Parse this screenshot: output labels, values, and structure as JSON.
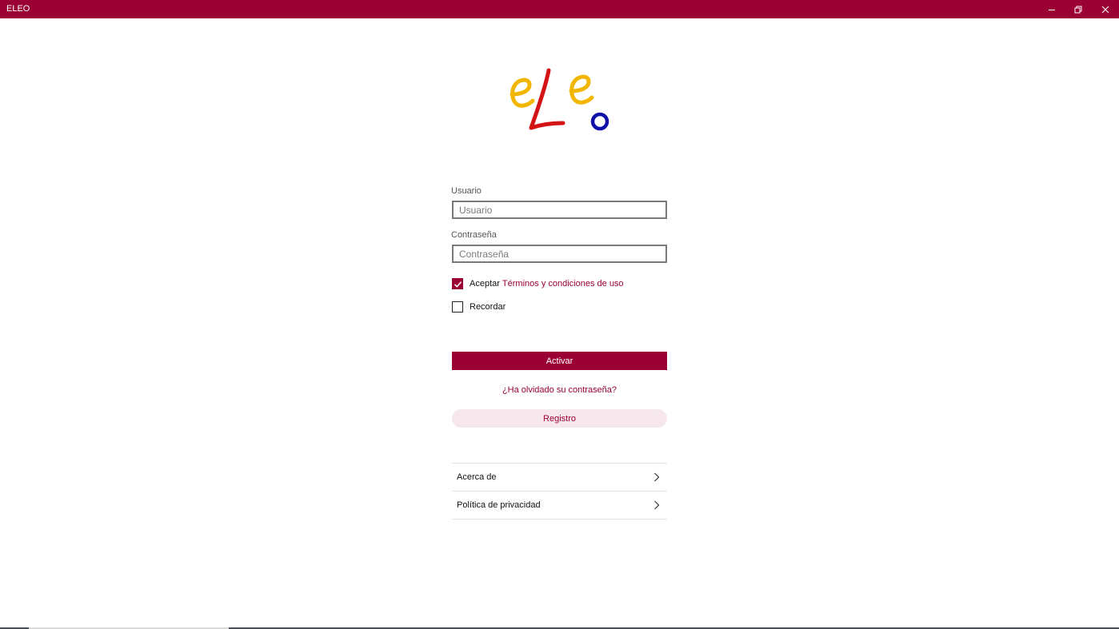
{
  "window": {
    "title": "ELEO",
    "minimize_icon": "minimize-icon",
    "maximize_icon": "restore-icon",
    "close_icon": "close-icon"
  },
  "logo": {
    "text": "eLeo",
    "colors": {
      "e": "#f2b600",
      "L": "#d41414",
      "o": "#1010a8"
    }
  },
  "form": {
    "username": {
      "label": "Usuario",
      "placeholder": "Usuario",
      "value": ""
    },
    "password": {
      "label": "Contraseña",
      "placeholder": "Contraseña",
      "value": ""
    },
    "accept": {
      "label": "Aceptar",
      "link": "Términos y condiciones de uso",
      "checked": true
    },
    "remember": {
      "label": "Recordar",
      "checked": false
    },
    "submit_label": "Activar",
    "forgot_label": "¿Ha olvidado su contraseña?",
    "register_label": "Registro"
  },
  "menu": {
    "items": [
      {
        "label": "Acerca de",
        "icon": "chevron-right-icon"
      },
      {
        "label": "Política de privacidad",
        "icon": "chevron-right-icon"
      }
    ]
  },
  "colors": {
    "accent": "#9b0035",
    "accent_light": "#f6e7ec"
  }
}
